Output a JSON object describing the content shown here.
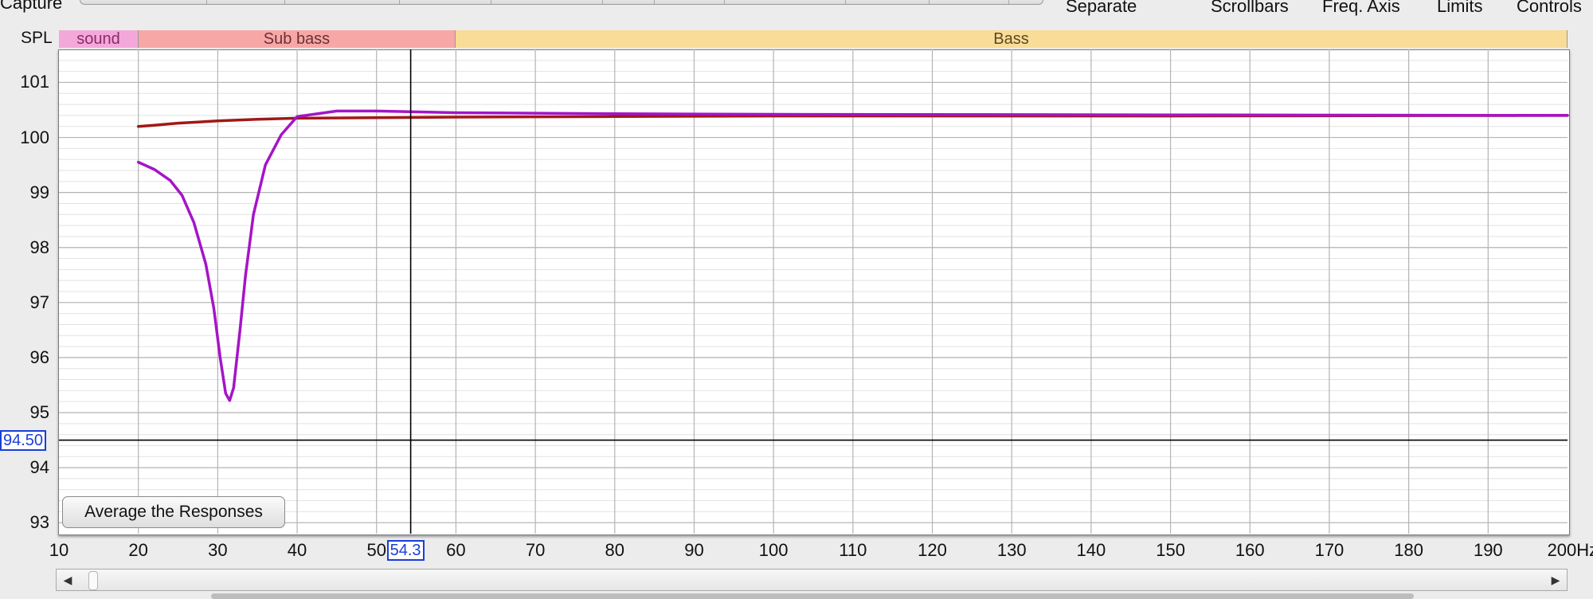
{
  "header": {
    "capture_label": "Capture",
    "menu": [
      "Separate",
      "Scrollbars",
      "Freq. Axis",
      "Limits",
      "Controls"
    ]
  },
  "bands": [
    {
      "label": "sound",
      "color": "#f4a8da",
      "text_color": "#8a2a6a"
    },
    {
      "label": "Sub bass",
      "color": "#f8a7a7",
      "text_color": "#6a3030"
    },
    {
      "label": "Bass",
      "color": "#f8dc98",
      "text_color": "#5a4a20"
    }
  ],
  "axis": {
    "y_title": "SPL",
    "y_ticks": [
      "101",
      "100",
      "99",
      "98",
      "97",
      "96",
      "95",
      "94",
      "93"
    ],
    "x_ticks": [
      "10",
      "20",
      "30",
      "40",
      "50",
      "60",
      "70",
      "80",
      "90",
      "100",
      "110",
      "120",
      "130",
      "140",
      "150",
      "160",
      "170",
      "180",
      "190",
      "200Hz"
    ]
  },
  "cursor": {
    "freq_readout": "54.3",
    "spl_readout": "94.50"
  },
  "controls": {
    "average_button": "Average the Responses"
  },
  "scrollbar": {
    "left_arrow": "◀",
    "right_arrow": "▶"
  },
  "chart_data": {
    "type": "line",
    "ylabel": "SPL",
    "xlim": [
      10,
      200
    ],
    "ylim": [
      92.8,
      101.6
    ],
    "cursor": {
      "x": 54.3,
      "y": 94.5
    },
    "series": [
      {
        "color": "#a01818",
        "x": [
          20,
          22,
          25,
          30,
          35,
          40,
          50,
          60,
          80,
          100,
          150,
          200
        ],
        "y": [
          100.2,
          100.22,
          100.26,
          100.3,
          100.33,
          100.35,
          100.36,
          100.37,
          100.38,
          100.39,
          100.39,
          100.4
        ]
      },
      {
        "color": "#a514c8",
        "x": [
          20,
          22,
          24,
          25.5,
          27,
          28.5,
          29.5,
          30.3,
          31,
          31.5,
          32,
          32.8,
          33.5,
          34.5,
          36,
          38,
          40,
          45,
          50,
          60,
          80,
          100,
          150,
          200
        ],
        "y": [
          99.55,
          99.42,
          99.22,
          98.95,
          98.45,
          97.7,
          96.9,
          96.0,
          95.35,
          95.22,
          95.45,
          96.5,
          97.5,
          98.6,
          99.5,
          100.05,
          100.38,
          100.48,
          100.48,
          100.45,
          100.43,
          100.42,
          100.41,
          100.4
        ]
      }
    ]
  }
}
